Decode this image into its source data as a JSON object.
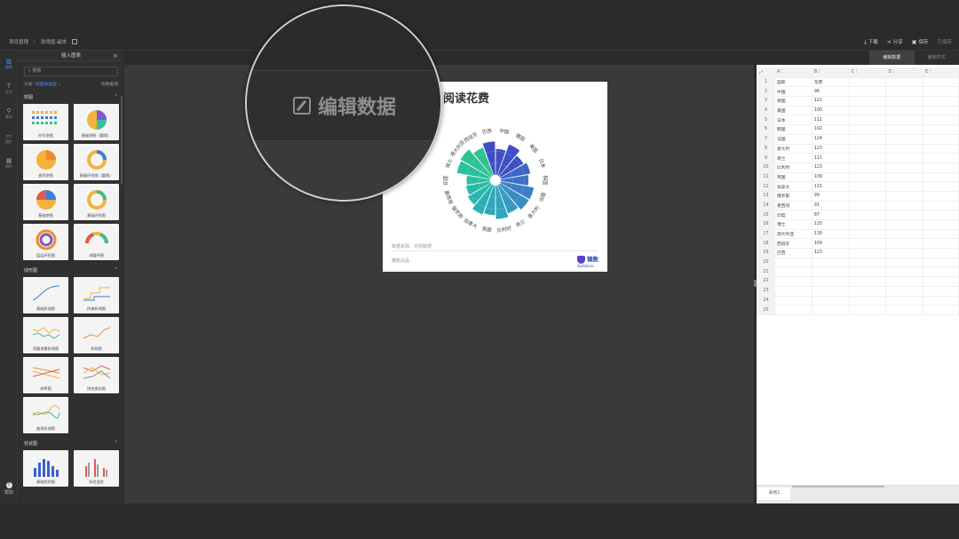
{
  "breadcrumb": {
    "project": "项目管理",
    "file": "玫瑰图-副本"
  },
  "top_actions": {
    "download": "下载",
    "share": "分享",
    "save": "保存",
    "saved_status": "已保存"
  },
  "left_rail": [
    {
      "label": "图表",
      "icon": "bar-chart-icon",
      "active": true
    },
    {
      "label": "文字",
      "icon": "text-icon",
      "active": false
    },
    {
      "label": "素材",
      "icon": "asset-icon",
      "active": false
    },
    {
      "label": "图片",
      "icon": "image-icon",
      "active": false
    },
    {
      "label": "组件",
      "icon": "component-icon",
      "active": false
    }
  ],
  "help": "帮助",
  "insert_panel": {
    "title": "插入图表",
    "search_placeholder": "搜索",
    "filter_label": "分类:",
    "filter_value": "按图表类型",
    "filter_right": "按数据源",
    "sections": [
      {
        "name": "饼图",
        "items": [
          "符号饼图",
          "基础饼图（圆角）",
          "变形饼图",
          "基础环形图（圆角）",
          "基础饼图",
          "基础环形图",
          "层层环形图",
          "半圆环图"
        ]
      },
      {
        "name": "线形图",
        "items": [
          "基础折线图",
          "阶梯折线图",
          "同量流量折线图",
          "折线图",
          "刻率图",
          "排名变化图",
          "曲线折线图"
        ]
      },
      {
        "name": "柱状图",
        "items": [
          "基础柱状图",
          "折柱混合"
        ]
      }
    ]
  },
  "magnifier": {
    "label": "编辑数据"
  },
  "chart": {
    "title": "阅读花费",
    "source": "数据来源：示例数据",
    "footer_left": "镝数出品",
    "logo_name": "镝数",
    "logo_url": "dydata.io"
  },
  "chart_data": {
    "type": "nightingale-rose",
    "title": "阅读花费",
    "categories": [
      "中国",
      "德国",
      "美国",
      "日本",
      "韩国",
      "法国",
      "意大利",
      "荷兰",
      "比利时",
      "英国",
      "加拿大",
      "俄罗斯",
      "墨西哥",
      "印度",
      "瑞士",
      "澳大利亚",
      "西班牙",
      "巴西"
    ],
    "values": [
      96,
      121,
      100,
      111,
      102,
      124,
      123,
      111,
      123,
      109,
      115,
      99,
      91,
      87,
      125,
      130,
      109,
      123
    ],
    "colors": [
      "#3d4fc4",
      "#3d4fc4",
      "#3d4fc4",
      "#3d64c6",
      "#3d6fc6",
      "#3d7fc7",
      "#378ec5",
      "#349ac2",
      "#2fa5bd",
      "#2fa5bd",
      "#2bb0b4",
      "#28b8aa",
      "#28b8aa",
      "#2ac09e",
      "#2ac09e",
      "#2ec293",
      "#2ec293",
      "#3d4fc4"
    ]
  },
  "right_panel": {
    "tabs": [
      "编辑数据",
      "编辑样式"
    ],
    "columns": [
      "A",
      "B",
      "C",
      "D",
      "E"
    ],
    "header_row": [
      "国家",
      "花费"
    ],
    "rows": [
      [
        "中国",
        "96"
      ],
      [
        "德国",
        "121"
      ],
      [
        "美国",
        "100"
      ],
      [
        "日本",
        "111"
      ],
      [
        "韩国",
        "102"
      ],
      [
        "法国",
        "124"
      ],
      [
        "意大利",
        "123"
      ],
      [
        "荷兰",
        "111"
      ],
      [
        "比利时",
        "123"
      ],
      [
        "英国",
        "109"
      ],
      [
        "加拿大",
        "115"
      ],
      [
        "俄罗斯",
        "99"
      ],
      [
        "墨西哥",
        "91"
      ],
      [
        "印度",
        "87"
      ],
      [
        "瑞士",
        "125"
      ],
      [
        "澳大利亚",
        "130"
      ],
      [
        "西班牙",
        "109"
      ],
      [
        "巴西",
        "123"
      ]
    ],
    "total_rows": 25,
    "sheet_tab": "表格1"
  }
}
